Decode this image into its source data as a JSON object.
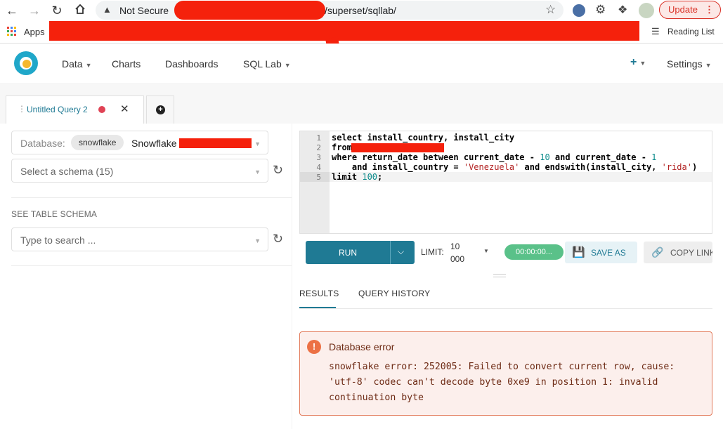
{
  "browser": {
    "not_secure": "Not Secure",
    "url_path": "/superset/sqllab/",
    "update_label": "Update",
    "apps_label": "Apps",
    "reading_list": "Reading List"
  },
  "nav": {
    "data": "Data",
    "charts": "Charts",
    "dashboards": "Dashboards",
    "sql_lab": "SQL Lab",
    "settings": "Settings"
  },
  "tabs": {
    "query_tab": "Untitled Query 2"
  },
  "left": {
    "database_label": "Database:",
    "db_badge": "snowflake",
    "db_name": "Snowflake",
    "schema_placeholder": "Select a schema (15)",
    "see_table_schema": "SEE TABLE SCHEMA",
    "table_search_placeholder": "Type to search ..."
  },
  "editor": {
    "line_numbers": [
      "1",
      "2",
      "3",
      "4",
      "5"
    ],
    "l1": "select install_country, install_city",
    "l2": "from",
    "l3_a": "where return_date between current_date - ",
    "l3_b": "10",
    "l3_c": " and current_date - ",
    "l3_d": "1",
    "l4_a": "    and install_country = ",
    "l4_b": "'Venezuela'",
    "l4_c": " and endswith(install_city, ",
    "l4_d": "'rida'",
    "l4_e": ")",
    "l5_a": "limit ",
    "l5_b": "100",
    "l5_c": ";"
  },
  "toolbar": {
    "run": "RUN",
    "limit_label": "LIMIT:",
    "limit_value_1": "10",
    "limit_value_2": "000",
    "timer": "00:00:00...",
    "save_as": "SAVE AS",
    "copy_link": "COPY LINK"
  },
  "results": {
    "tab_results": "RESULTS",
    "tab_history": "QUERY HISTORY",
    "error_title": "Database error",
    "error_line1": "snowflake error: 252005: Failed to convert current row, cause:",
    "error_line2": "'utf-8' codec can't decode byte 0xe9 in position 1: invalid",
    "error_line3": "continuation byte"
  },
  "colors": {
    "primary": "#1f7a94",
    "success": "#5ac189",
    "error_border": "#e27a5a",
    "error_bg": "#fcefec",
    "redaction": "#f5210c"
  }
}
